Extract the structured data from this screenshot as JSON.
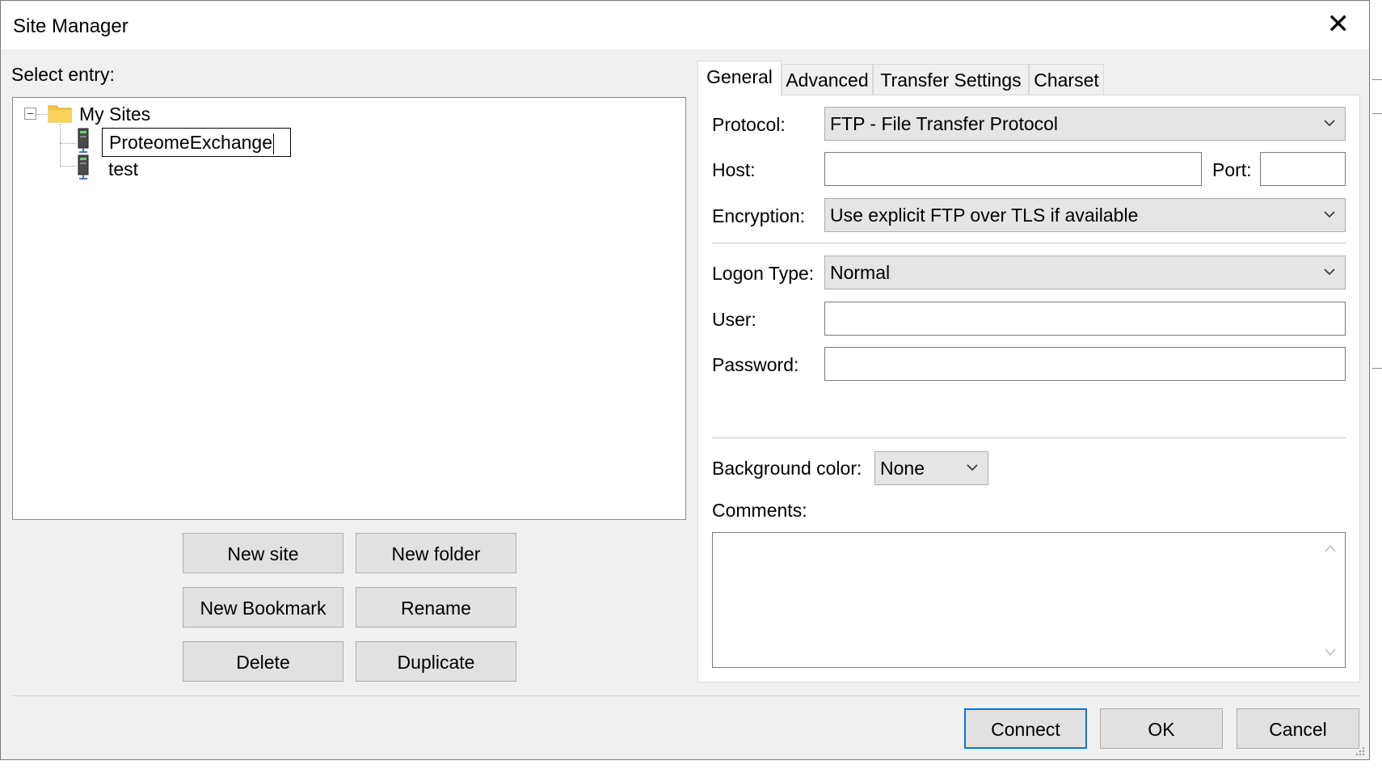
{
  "window": {
    "title": "Site Manager",
    "close_glyph": "✕"
  },
  "tree": {
    "label": "Select entry:",
    "expander_glyph": "−",
    "root": {
      "label": "My Sites",
      "icon": "folder-icon"
    },
    "sites": [
      {
        "label": "ProteomeExchange",
        "editing": true,
        "icon": "server-icon"
      },
      {
        "label": "test",
        "editing": false,
        "icon": "server-icon"
      }
    ]
  },
  "tree_buttons": {
    "new_site": "New site",
    "new_folder": "New folder",
    "new_bookmark": "New Bookmark",
    "rename": "Rename",
    "delete": "Delete",
    "duplicate": "Duplicate"
  },
  "tabs": [
    {
      "label": "General",
      "active": true
    },
    {
      "label": "Advanced",
      "active": false
    },
    {
      "label": "Transfer Settings",
      "active": false
    },
    {
      "label": "Charset",
      "active": false
    }
  ],
  "general": {
    "protocol_label": "Protocol:",
    "protocol_value": "FTP - File Transfer Protocol",
    "host_label": "Host:",
    "host_value": "",
    "port_label": "Port:",
    "port_value": "",
    "encryption_label": "Encryption:",
    "encryption_value": "Use explicit FTP over TLS if available",
    "logon_label": "Logon Type:",
    "logon_value": "Normal",
    "user_label": "User:",
    "user_value": "",
    "password_label": "Password:",
    "password_value": "",
    "bgcolor_label": "Background color:",
    "bgcolor_value": "None",
    "comments_label": "Comments:",
    "comments_value": ""
  },
  "footer": {
    "connect": "Connect",
    "ok": "OK",
    "cancel": "Cancel"
  },
  "colors": {
    "dialog_bg": "#f0f0f0",
    "focus_border": "#0078d7",
    "folder": "#f8c33a"
  }
}
